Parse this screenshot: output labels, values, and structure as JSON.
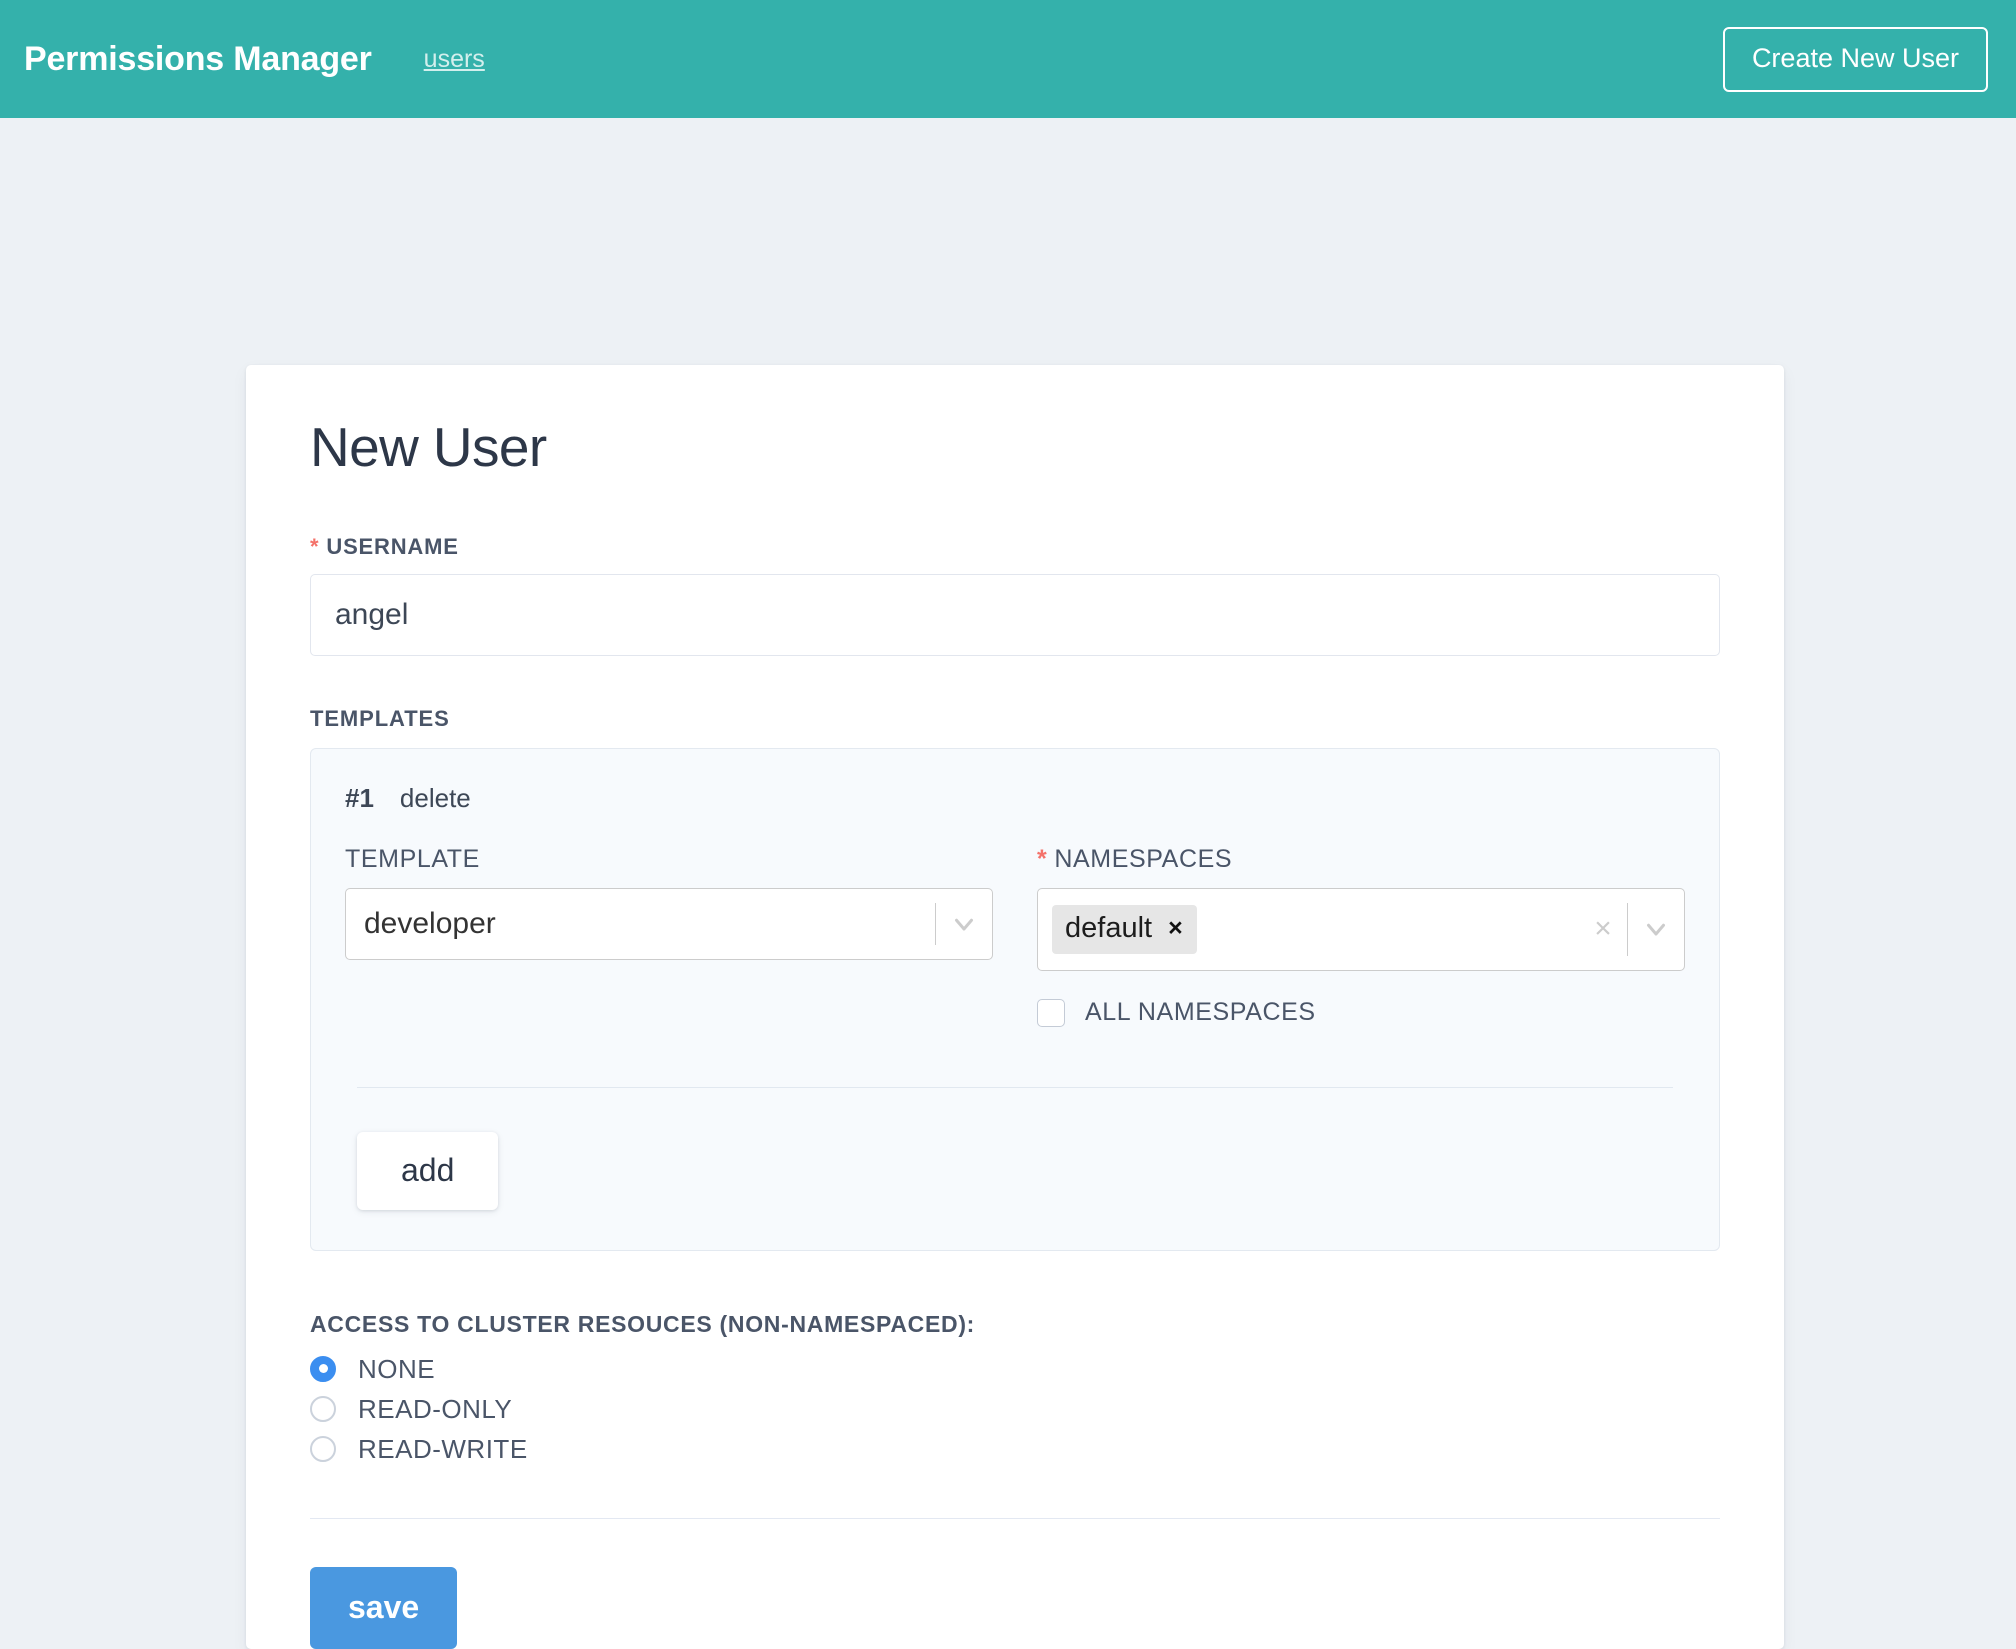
{
  "theme": {
    "header_bg": "#34b1ab",
    "page_bg": "#edf1f5",
    "panel_bg": "#f7fafd",
    "accent_blue": "#4a98e0",
    "radio_blue": "#3b8ef0",
    "required_red": "#f4726a",
    "text_dark": "#2d3748"
  },
  "header": {
    "brand": "Permissions Manager",
    "nav_link": "users",
    "create_button": "Create New User"
  },
  "form": {
    "title": "New User",
    "username": {
      "label": "USERNAME",
      "required_marker": "*",
      "value": "angel",
      "placeholder": ""
    },
    "templates_section_label": "TEMPLATES",
    "templates": [
      {
        "index_label": "#1",
        "delete_label": "delete",
        "template": {
          "label": "TEMPLATE",
          "value": "developer",
          "chevron_icon": "chevron-down-icon"
        },
        "namespaces": {
          "label": "NAMESPACES",
          "required_marker": "*",
          "tags": [
            {
              "label": "default",
              "remove_icon": "×"
            }
          ],
          "clear_icon": "×",
          "chevron_icon": "chevron-down-icon",
          "all_namespaces_label": "ALL NAMESPACES",
          "all_namespaces_checked": false
        }
      }
    ],
    "add_button": "add",
    "access": {
      "label": "ACCESS TO CLUSTER RESOUCES (NON-NAMESPACED):",
      "options": [
        {
          "label": "NONE",
          "selected": true
        },
        {
          "label": "READ-ONLY",
          "selected": false
        },
        {
          "label": "READ-WRITE",
          "selected": false
        }
      ]
    },
    "save_button": "save"
  }
}
